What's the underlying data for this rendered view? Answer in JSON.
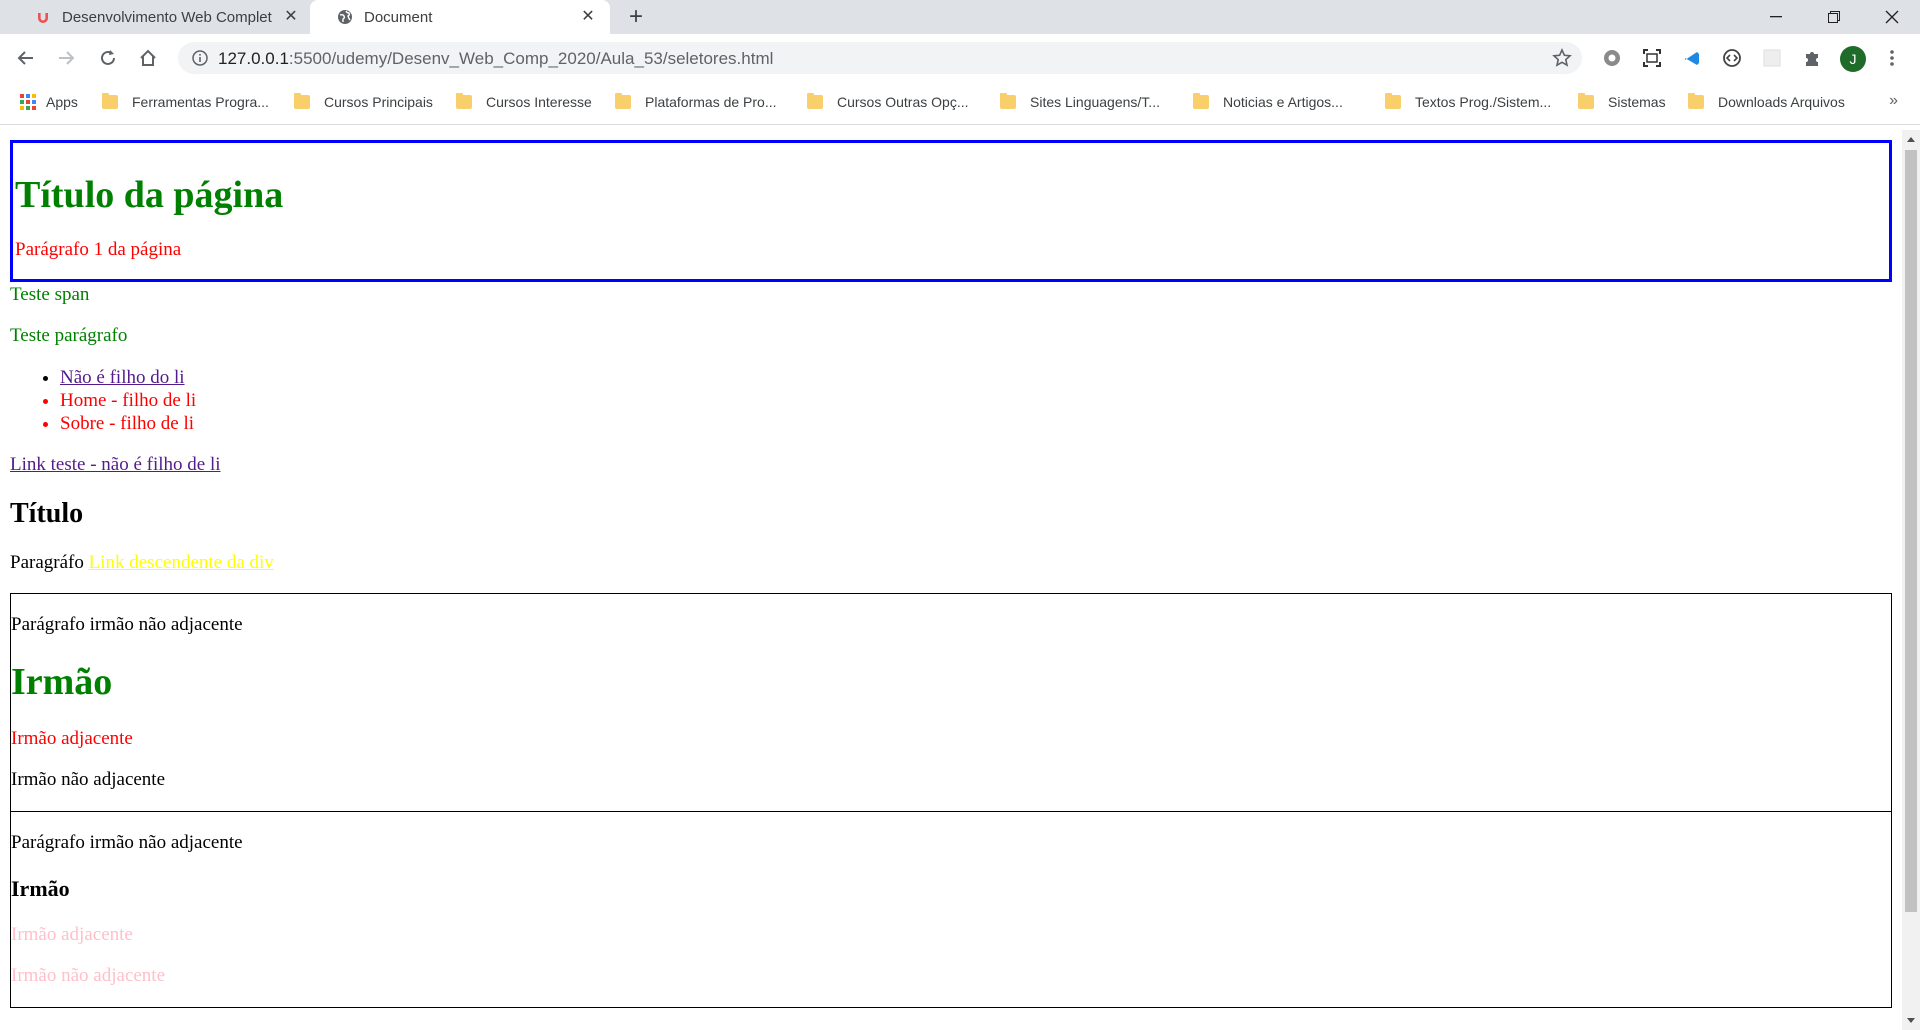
{
  "browser": {
    "tabs": [
      {
        "title": "Desenvolvimento Web Completo",
        "active": false
      },
      {
        "title": "Document",
        "active": true
      }
    ],
    "url_host": "127.0.0.1",
    "url_path": ":5500/udemy/Desenv_Web_Comp_2020/Aula_53/seletores.html",
    "avatar_letter": "J",
    "bookmarks": [
      {
        "label": "Apps",
        "icon": "apps-grid-icon"
      },
      {
        "label": "Ferramentas Progra...",
        "icon": "folder-icon"
      },
      {
        "label": "Cursos Principais",
        "icon": "folder-icon"
      },
      {
        "label": "Cursos Interesse",
        "icon": "folder-icon"
      },
      {
        "label": "Plataformas de Pro...",
        "icon": "folder-icon"
      },
      {
        "label": "Cursos Outras Opç...",
        "icon": "folder-icon"
      },
      {
        "label": "Sites Linguagens/T...",
        "icon": "folder-icon"
      },
      {
        "label": "Noticias e Artigos...",
        "icon": "folder-icon"
      },
      {
        "label": "Textos Prog./Sistem...",
        "icon": "folder-icon"
      },
      {
        "label": "Sistemas",
        "icon": "folder-icon"
      },
      {
        "label": "Downloads Arquivos",
        "icon": "folder-icon"
      }
    ],
    "bookmarks_overflow": "»"
  },
  "page": {
    "header_title": "Título da página",
    "header_paragraph": "Parágrafo 1 da página",
    "span_text": "Teste span",
    "paragraph_text": "Teste parágrafo",
    "list_items": [
      "Não é filho do li",
      "Home - filho de li",
      "Sobre - filho de li"
    ],
    "link_outside": "Link teste - não é filho de li",
    "section_title": "Título",
    "section_paragraph_prefix": "Paragráfo",
    "section_link": "Link descendente da div",
    "block1": {
      "p_before": "Parágrafo irmão não adjacente",
      "heading": "Irmão",
      "adjacent": "Irmão adjacente",
      "non_adjacent": "Irmão não adjacente"
    },
    "block2": {
      "p_before": "Parágrafo irmão não adjacente",
      "heading": "Irmão",
      "adjacent": "Irmão adjacente",
      "non_adjacent": "Irmão não adjacente"
    }
  },
  "colors": {
    "header_border": "#0000ff",
    "green": "#008000",
    "red": "#ff0000",
    "yellow": "#ffff00",
    "pink": "#ffc0cb"
  }
}
